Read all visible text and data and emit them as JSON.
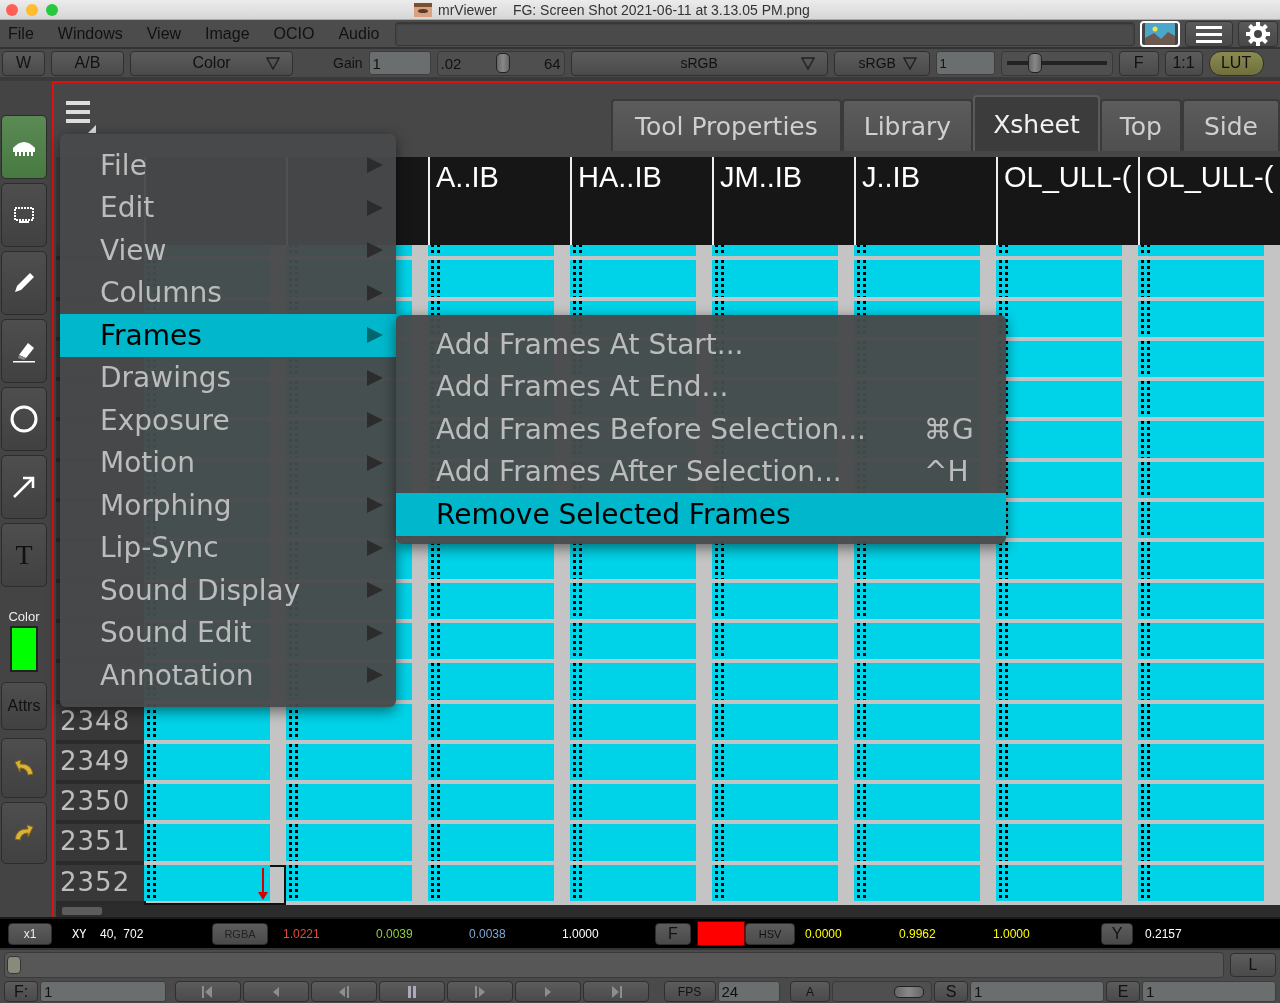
{
  "window": {
    "app": "mrViewer",
    "file": "FG: Screen Shot 2021-06-11 at 3.13.05 PM.png"
  },
  "menubar": [
    "File",
    "Windows",
    "View",
    "Image",
    "OCIO",
    "Audio"
  ],
  "toolbar": {
    "wipe": "W",
    "compare": "A/B",
    "channel": "Color",
    "gain_label": "Gain",
    "gain": "1",
    "exposure_min": ".02",
    "exposure_max": "64",
    "exposure": {
      "level": 0.5
    },
    "input_space": "sRGB",
    "display_space": "sRGB",
    "gamma": "1",
    "gamma_slider": {
      "level": 0.28
    },
    "fit": "F",
    "ratio": "1:1",
    "lut": "LUT",
    "lut_on": true
  },
  "tools": [
    {
      "kind": "icon",
      "selected": true
    },
    {
      "kind": "icon",
      "selected": false
    },
    {
      "kind": "icon",
      "selected": false
    },
    {
      "kind": "icon",
      "selected": false
    },
    {
      "kind": "icon",
      "selected": false
    },
    {
      "kind": "icon",
      "selected": false
    },
    {
      "kind": "text",
      "label": "T",
      "selected": false
    }
  ],
  "pen": {
    "label": "Color",
    "color": "#00ff00"
  },
  "attrs": "Attrs",
  "panel": {
    "tabs": [
      {
        "label": "Tool Properties",
        "selected": false
      },
      {
        "label": "Library",
        "selected": false
      },
      {
        "label": "Xsheet",
        "selected": true
      },
      {
        "label": "Top",
        "selected": false
      },
      {
        "label": "Side",
        "selected": false
      }
    ]
  },
  "xsheet": {
    "columns": [
      "A..IB",
      "HA..IB",
      "JM..IB",
      "J..IB",
      "OL_ULL-(",
      "OL_ULL-("
    ],
    "frames": [
      {
        "frame": "2348",
        "selected": false
      },
      {
        "frame": "2349",
        "selected": false
      },
      {
        "frame": "2350",
        "selected": false
      },
      {
        "frame": "2351",
        "selected": false
      },
      {
        "frame": "2352",
        "selected": true
      }
    ]
  },
  "context_menu": [
    {
      "label": "File",
      "selected": false
    },
    {
      "label": "Edit",
      "selected": false
    },
    {
      "label": "View",
      "selected": false
    },
    {
      "label": "Columns",
      "selected": false
    },
    {
      "label": "Frames",
      "selected": true
    },
    {
      "label": "Drawings",
      "selected": false
    },
    {
      "label": "Exposure",
      "selected": false
    },
    {
      "label": "Motion",
      "selected": false
    },
    {
      "label": "Morphing",
      "selected": false
    },
    {
      "label": "Lip-Sync",
      "selected": false
    },
    {
      "label": "Sound Display",
      "selected": false
    },
    {
      "label": "Sound Edit",
      "selected": false
    },
    {
      "label": "Annotation",
      "selected": false
    }
  ],
  "submenu": [
    {
      "label": "Add Frames At Start...",
      "selected": false
    },
    {
      "label": "Add Frames At End...",
      "selected": false
    },
    {
      "label": "Add Frames Before Selection...",
      "shortcut": "⌘G",
      "selected": false
    },
    {
      "label": "Add Frames After Selection...",
      "shortcut": "^H",
      "selected": false
    },
    {
      "label": "Remove Selected Frames",
      "selected": true
    }
  ],
  "pixel_bar": {
    "zoom": "x1",
    "xy_label": "XY",
    "xy": "40,  702",
    "rgba_button": "RGBA",
    "rgba": [
      {
        "value": "1.0221",
        "color": "#e04a3c"
      },
      {
        "value": "0.0039",
        "color": "#8ed13a"
      },
      {
        "value": "0.0038",
        "color": "#7fa7d4"
      },
      {
        "value": "1.0000",
        "color": "#ffffff"
      }
    ],
    "f_button": "F",
    "swatch": {
      "color": "#ff0000"
    },
    "hsv_button": "HSV",
    "hsv": [
      {
        "value": "0.0000",
        "color": "#ffff00"
      },
      {
        "value": "0.9962",
        "color": "#ffff00"
      },
      {
        "value": "1.0000",
        "color": "#ffff00"
      }
    ],
    "y_button": "Y",
    "luma": "0.2157"
  },
  "timeline": {
    "level": 0,
    "l_button": "L"
  },
  "transport": {
    "frame_label": "F:",
    "frame": "1",
    "fps_label": "FPS",
    "fps": "24",
    "audio_button": "A",
    "volume": {
      "level": 0.9
    },
    "start_label": "S",
    "start": "1",
    "end_label": "E",
    "end": "1"
  }
}
